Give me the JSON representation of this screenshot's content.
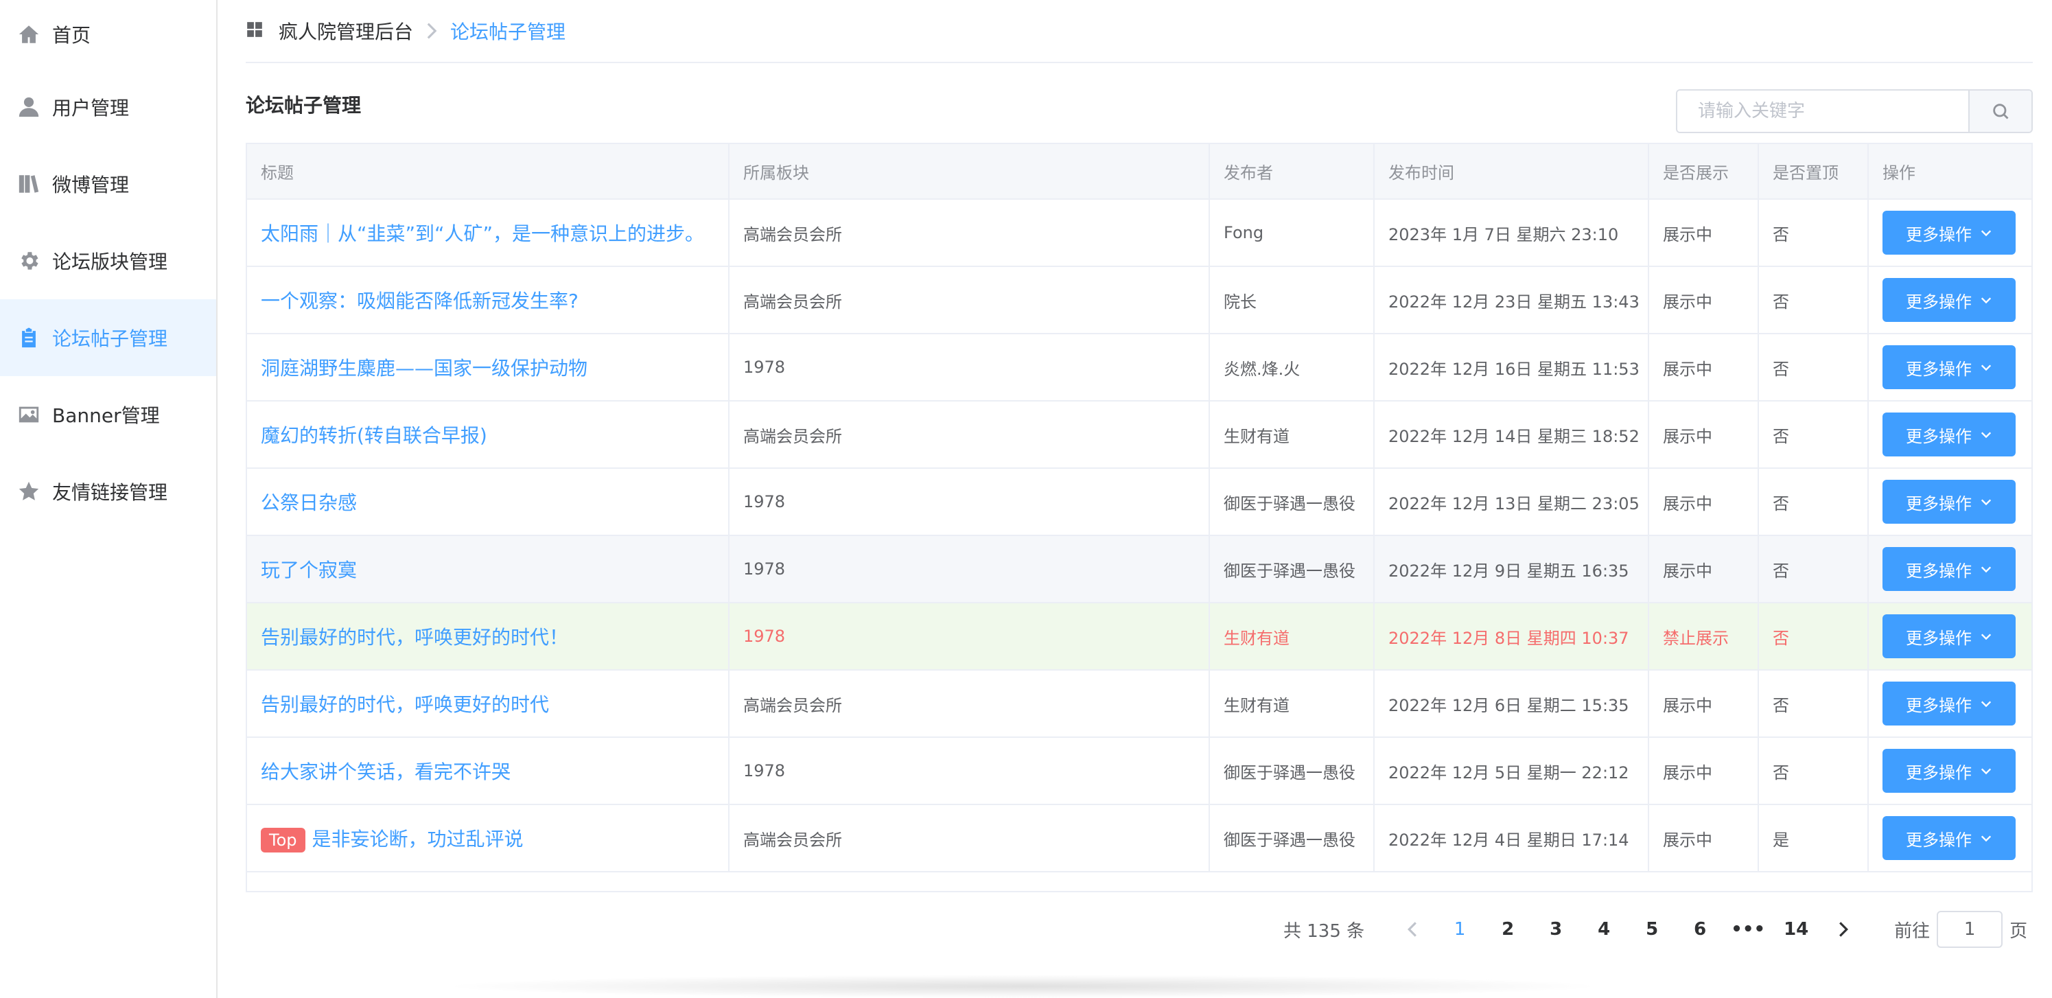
{
  "sidebar": {
    "items": [
      {
        "label": "首页",
        "icon": "home-icon"
      },
      {
        "label": "用户管理",
        "icon": "user-icon"
      },
      {
        "label": "微博管理",
        "icon": "book-icon"
      },
      {
        "label": "论坛版块管理",
        "icon": "gear-icon"
      },
      {
        "label": "论坛帖子管理",
        "icon": "clipboard-icon",
        "active": true
      },
      {
        "label": "Banner管理",
        "icon": "image-icon"
      },
      {
        "label": "友情链接管理",
        "icon": "star-icon"
      }
    ]
  },
  "breadcrumb": {
    "home": "疯人院管理后台",
    "current": "论坛帖子管理"
  },
  "page": {
    "title": "论坛帖子管理"
  },
  "search": {
    "placeholder": "请输入关键字"
  },
  "table": {
    "headers": [
      "标题",
      "所属板块",
      "发布者",
      "发布时间",
      "是否展示",
      "是否置顶",
      "操作"
    ],
    "action_label": "更多操作",
    "top_tag": "Top",
    "rows": [
      {
        "title": "太阳雨｜从“韭菜”到“人矿”，是一种意识上的进步。",
        "board": "高端会员会所",
        "author": "Fong",
        "time": "2023年 1月 7日 星期六 23:10",
        "shown": "展示中",
        "pinned": "否"
      },
      {
        "title": "一个观察：吸烟能否降低新冠发生率?",
        "board": "高端会员会所",
        "author": "院长",
        "time": "2022年 12月 23日 星期五 13:43",
        "shown": "展示中",
        "pinned": "否"
      },
      {
        "title": "洞庭湖野生麋鹿——国家一级保护动物",
        "board": "1978",
        "author": "炎燃.烽.火",
        "time": "2022年 12月 16日 星期五 11:53",
        "shown": "展示中",
        "pinned": "否"
      },
      {
        "title": "魔幻的转折(转自联合早报)",
        "board": "高端会员会所",
        "author": "生财有道",
        "time": "2022年 12月 14日 星期三 18:52",
        "shown": "展示中",
        "pinned": "否"
      },
      {
        "title": "公祭日杂感",
        "board": "1978",
        "author": "御医于驿遇一愚役",
        "time": "2022年 12月 13日 星期二 23:05",
        "shown": "展示中",
        "pinned": "否"
      },
      {
        "title": "玩了个寂寞",
        "board": "1978",
        "author": "御医于驿遇一愚役",
        "time": "2022年 12月 9日 星期五 16:35",
        "shown": "展示中",
        "pinned": "否"
      },
      {
        "title": "告别最好的时代，呼唤更好的时代！",
        "board": "1978",
        "author": "生财有道",
        "time": "2022年 12月 8日 星期四 10:37",
        "shown": "禁止展示",
        "pinned": "否"
      },
      {
        "title": "告别最好的时代，呼唤更好的时代",
        "board": "高端会员会所",
        "author": "生财有道",
        "time": "2022年 12月 6日 星期二 15:35",
        "shown": "展示中",
        "pinned": "否"
      },
      {
        "title": "给大家讲个笑话，看完不许哭",
        "board": "1978",
        "author": "御医于驿遇一愚役",
        "time": "2022年 12月 5日 星期一 22:12",
        "shown": "展示中",
        "pinned": "否"
      },
      {
        "title": "是非妄论断，功过乱评说",
        "board": "高端会员会所",
        "author": "御医于驿遇一愚役",
        "time": "2022年 12月 4日 星期日 17:14",
        "shown": "展示中",
        "pinned": "是",
        "top": true
      }
    ]
  },
  "pagination": {
    "total": "共 135 条",
    "pages": [
      "1",
      "2",
      "3",
      "4",
      "5",
      "6",
      "•••",
      "14"
    ],
    "current": "1",
    "goto_prefix": "前往",
    "goto_value": "1",
    "goto_suffix": "页"
  },
  "colors": {
    "accent": "#409eff",
    "danger": "#f56c6c",
    "banned_row_bg": "#f0f9eb"
  }
}
